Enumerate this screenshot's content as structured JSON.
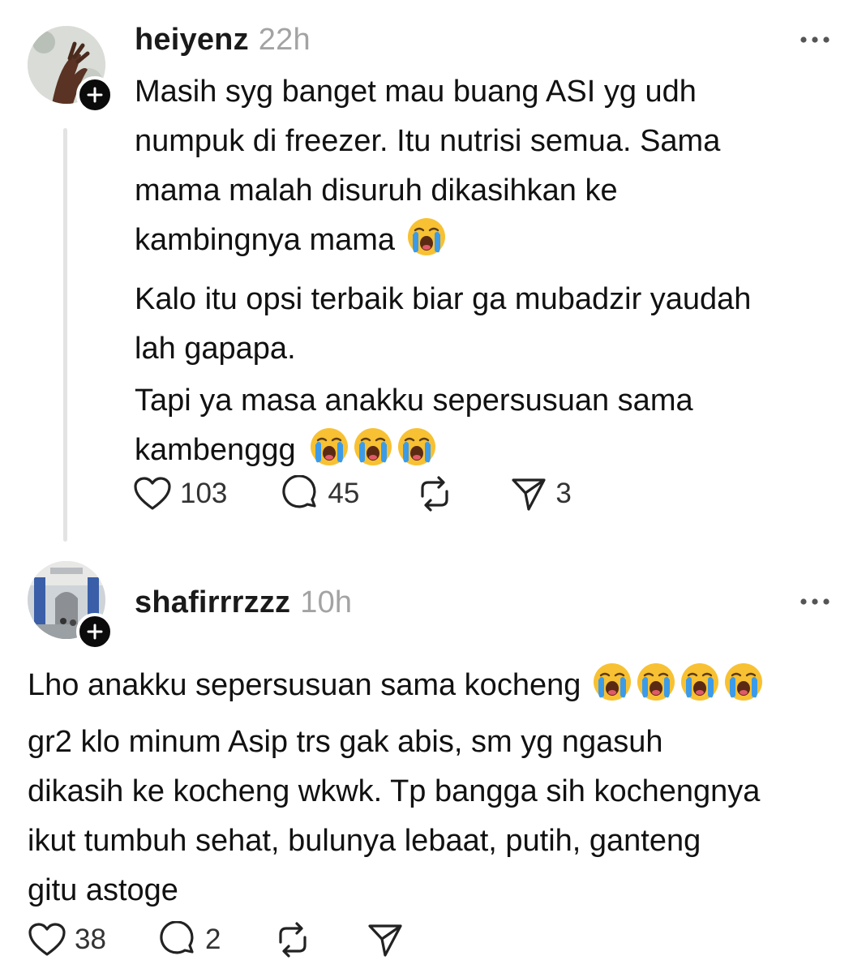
{
  "posts": [
    {
      "username": "heiyenz",
      "time": "22h",
      "avatar_icon": "hand-photo-avatar",
      "body_lines": [
        "Masih syg banget mau buang ASI yg udh",
        "numpuk di freezer. Itu nutrisi semua. Sama",
        "mama malah disuruh dikasihkan ke",
        "kambingnya mama",
        "Kalo itu opsi terbaik biar ga mubadzir yaudah",
        "lah gapapa.",
        "Tapi ya masa anakku sepersusuan sama",
        "kambenggg"
      ],
      "emoji": "loudly-crying-face",
      "likes": "103",
      "replies": "45",
      "shares": "3"
    },
    {
      "username": "shafirrrzzz",
      "time": "10h",
      "avatar_icon": "building-interior-avatar",
      "body_lines": [
        "Lho anakku sepersusuan sama kocheng",
        "gr2 klo minum Asip trs gak abis, sm yg ngasuh",
        "dikasih ke kocheng wkwk. Tp bangga sih kochengnya",
        "ikut tumbuh sehat, bulunya lebaat, putih, ganteng",
        "gitu astoge"
      ],
      "emoji": "loudly-crying-face",
      "likes": "38",
      "replies": "2"
    }
  ],
  "colors": {
    "text": "#111111",
    "muted": "#a3a3a3",
    "thread_line": "#e3e3e3",
    "emoji_face": "#f7c133",
    "emoji_tears": "#3b9be8"
  }
}
